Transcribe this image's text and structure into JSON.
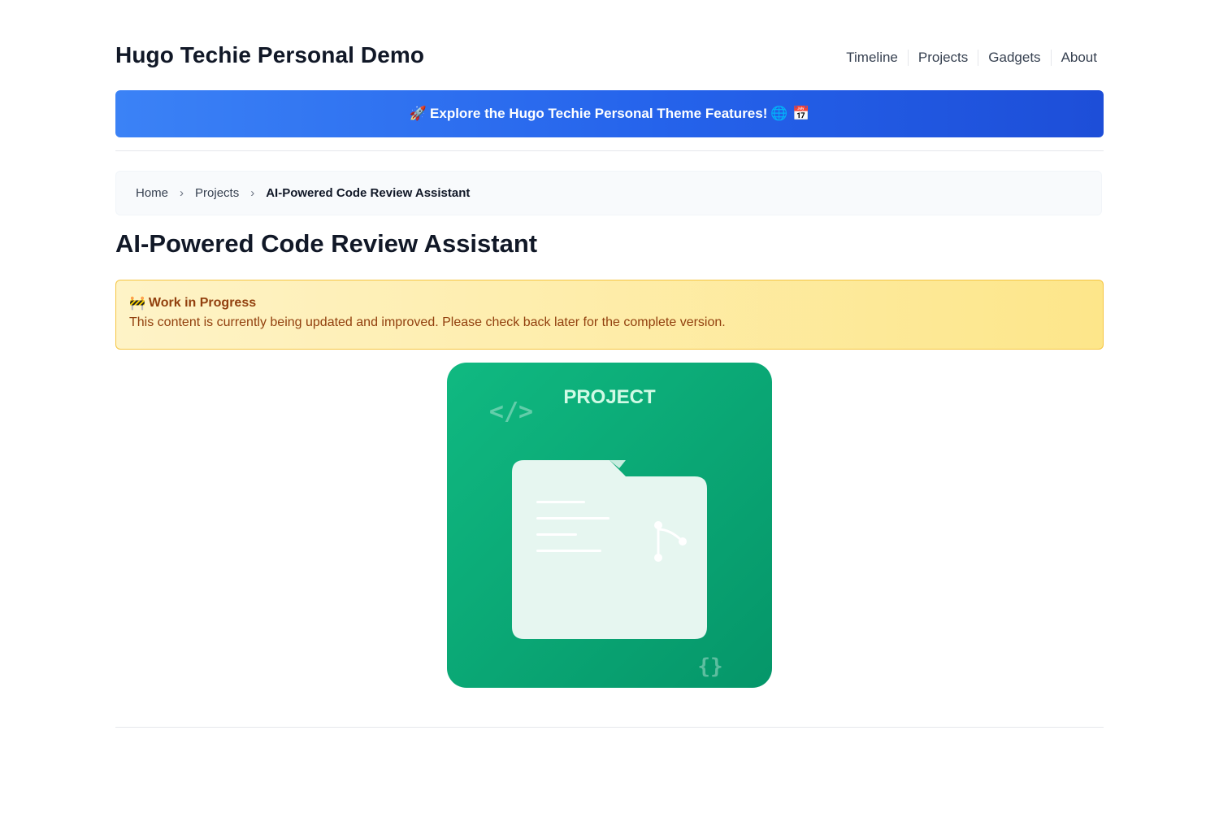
{
  "site": {
    "title": "Hugo Techie Personal Demo"
  },
  "nav": {
    "items": [
      {
        "label": "Timeline"
      },
      {
        "label": "Projects"
      },
      {
        "label": "Gadgets"
      },
      {
        "label": "About"
      }
    ]
  },
  "banner": {
    "emoji_start": "🚀",
    "text": "Explore the Hugo Techie Personal Theme Features!",
    "emoji_end": "🌐 📅"
  },
  "breadcrumb": {
    "home": "Home",
    "section": "Projects",
    "current": "AI-Powered Code Review Assistant",
    "separator": "›"
  },
  "page": {
    "title": "AI-Powered Code Review Assistant"
  },
  "notice": {
    "emoji": "🚧",
    "title": "Work in Progress",
    "text": "This content is currently being updated and improved. Please check back later for the complete version."
  },
  "project_image": {
    "label": "PROJECT",
    "code_symbol": "</>",
    "braces_symbol": "{}",
    "colors": {
      "background_start": "#10b981",
      "background_end": "#059669",
      "folder": "#e6f6f0"
    },
    "icons": [
      "code-icon",
      "folder-icon",
      "git-branch-icon",
      "braces-icon"
    ]
  }
}
